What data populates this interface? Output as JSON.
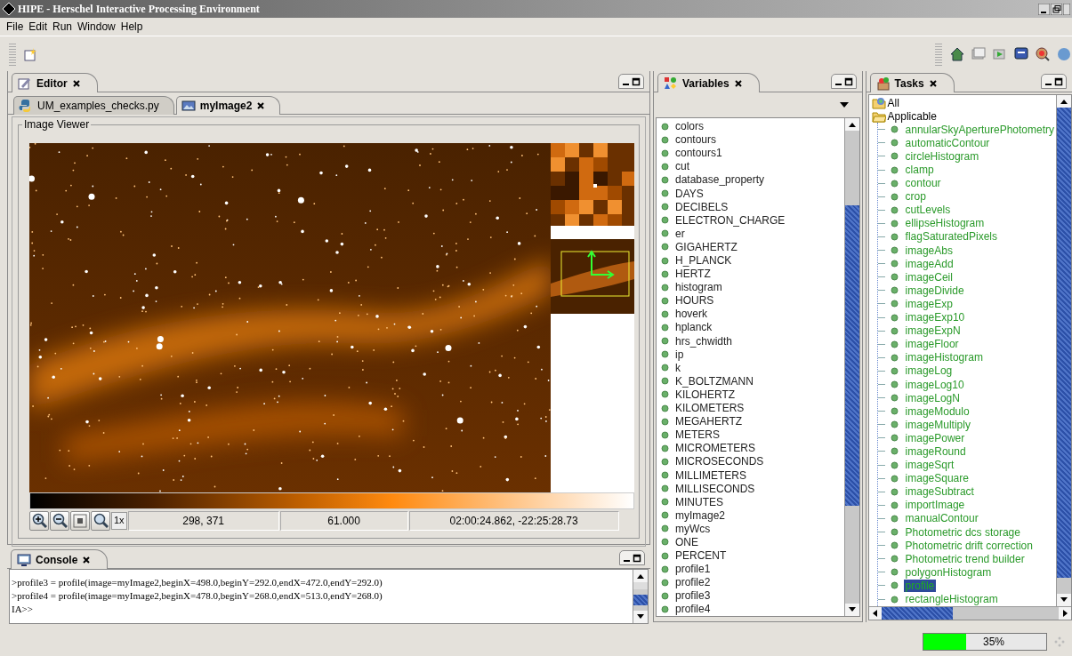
{
  "window": {
    "title": "HIPE - Herschel Interactive Processing Environment"
  },
  "menu": [
    "File",
    "Edit",
    "Run",
    "Window",
    "Help"
  ],
  "editor": {
    "tab": {
      "label": "Editor",
      "selected": true
    },
    "files": [
      {
        "label": "UM_examples_checks.py",
        "kind": "python",
        "selected": false
      },
      {
        "label": "myImage2",
        "kind": "image",
        "selected": true
      }
    ],
    "viewer": {
      "title": "Image Viewer",
      "zoom_label": "1x",
      "pixel": "298, 371",
      "value": "61.000",
      "coords": "02:00:24.862, -22:25:28.73"
    }
  },
  "console": {
    "tab": {
      "label": "Console",
      "selected": true
    },
    "lines": [
      ">profile3 = profile(image=myImage2,beginX=498.0,beginY=292.0,endX=472.0,endY=292.0)",
      ">profile4 = profile(image=myImage2,beginX=478.0,beginY=268.0,endX=513.0,endY=268.0)",
      "IA>>"
    ]
  },
  "variables": {
    "tab": {
      "label": "Variables",
      "selected": true
    },
    "items": [
      "colors",
      "contours",
      "contours1",
      "cut",
      "database_property",
      "DAYS",
      "DECIBELS",
      "ELECTRON_CHARGE",
      "er",
      "GIGAHERTZ",
      "H_PLANCK",
      "HERTZ",
      "histogram",
      "HOURS",
      "hoverk",
      "hplanck",
      "hrs_chwidth",
      "ip",
      "k",
      "K_BOLTZMANN",
      "KILOHERTZ",
      "KILOMETERS",
      "MEGAHERTZ",
      "METERS",
      "MICROMETERS",
      "MICROSECONDS",
      "MILLIMETERS",
      "MILLISECONDS",
      "MINUTES",
      "myImage2",
      "myWcs",
      "ONE",
      "PERCENT",
      "profile1",
      "profile2",
      "profile3",
      "profile4"
    ]
  },
  "tasks": {
    "tab": {
      "label": "Tasks",
      "selected": true
    },
    "tree": [
      {
        "label": "All",
        "kind": "all"
      },
      {
        "label": "Applicable",
        "kind": "folder",
        "expanded": true,
        "children": [
          {
            "label": "annularSkyAperturePhotometry",
            "selected": false
          },
          {
            "label": "automaticContour",
            "selected": false
          },
          {
            "label": "circleHistogram",
            "selected": false
          },
          {
            "label": "clamp",
            "selected": false
          },
          {
            "label": "contour",
            "selected": false
          },
          {
            "label": "crop",
            "selected": false
          },
          {
            "label": "cutLevels",
            "selected": false
          },
          {
            "label": "ellipseHistogram",
            "selected": false
          },
          {
            "label": "flagSaturatedPixels",
            "selected": false
          },
          {
            "label": "imageAbs",
            "selected": false
          },
          {
            "label": "imageAdd",
            "selected": false
          },
          {
            "label": "imageCeil",
            "selected": false
          },
          {
            "label": "imageDivide",
            "selected": false
          },
          {
            "label": "imageExp",
            "selected": false
          },
          {
            "label": "imageExp10",
            "selected": false
          },
          {
            "label": "imageExpN",
            "selected": false
          },
          {
            "label": "imageFloor",
            "selected": false
          },
          {
            "label": "imageHistogram",
            "selected": false
          },
          {
            "label": "imageLog",
            "selected": false
          },
          {
            "label": "imageLog10",
            "selected": false
          },
          {
            "label": "imageLogN",
            "selected": false
          },
          {
            "label": "imageModulo",
            "selected": false
          },
          {
            "label": "imageMultiply",
            "selected": false
          },
          {
            "label": "imagePower",
            "selected": false
          },
          {
            "label": "imageRound",
            "selected": false
          },
          {
            "label": "imageSqrt",
            "selected": false
          },
          {
            "label": "imageSquare",
            "selected": false
          },
          {
            "label": "imageSubtract",
            "selected": false
          },
          {
            "label": "importImage",
            "selected": false
          },
          {
            "label": "manualContour",
            "selected": false
          },
          {
            "label": "Photometric dcs storage",
            "selected": false
          },
          {
            "label": "Photometric drift correction",
            "selected": false
          },
          {
            "label": "Photometric trend builder",
            "selected": false
          },
          {
            "label": "polygonHistogram",
            "selected": false
          },
          {
            "label": "profile",
            "selected": true
          },
          {
            "label": "rectangleHistogram",
            "selected": false
          }
        ]
      }
    ]
  },
  "status_bar": {
    "progress": {
      "level": 0.35,
      "reading": "35%"
    }
  }
}
